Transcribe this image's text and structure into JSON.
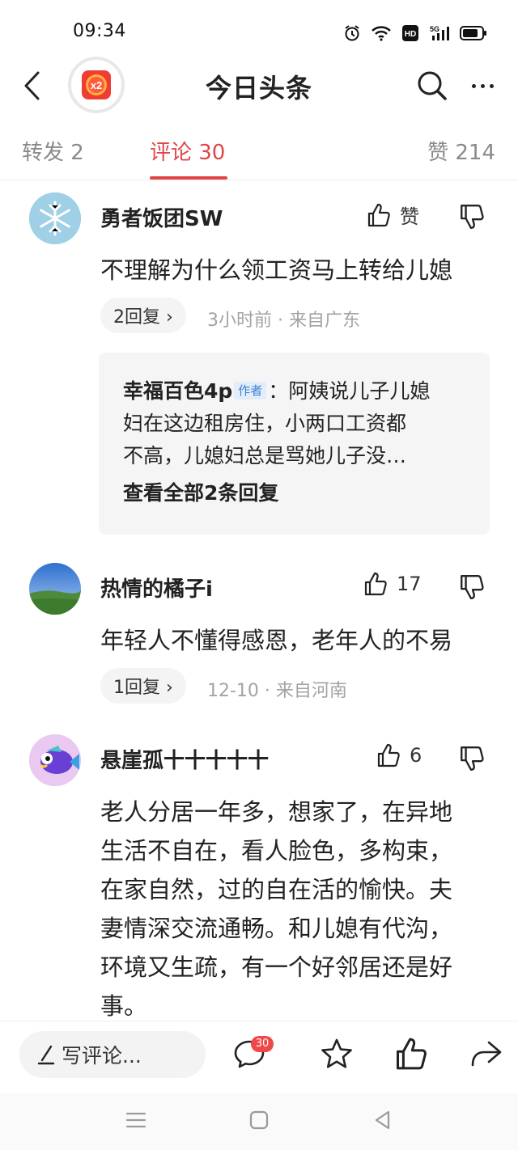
{
  "status_bar": {
    "time": "09:34",
    "icons": [
      "alarm-icon",
      "wifi-icon",
      "hd-icon",
      "5g-signal-icon",
      "battery-icon"
    ],
    "hd_label": "HD",
    "network_label": "5G"
  },
  "header": {
    "title": "今日头条",
    "redpack_label": "x2"
  },
  "tabs": {
    "repost": "转发 2",
    "comments": "评论 30",
    "likes": "赞 214"
  },
  "comments": [
    {
      "username": "勇者饭团SW",
      "like_label": "赞",
      "text": "不理解为什么领工资马上转给儿媳",
      "replies": "2回复 ›",
      "meta": "3小时前 · 来自广东",
      "reply_preview": {
        "user": "幸福百色4p",
        "badge": "作者",
        "text_line1": "：阿姨说儿子儿媳",
        "text_line2": "妇在这边租房住，小两口工资都",
        "text_line3": "不高，儿媳妇总是骂她儿子没…",
        "view_all": "查看全部2条回复"
      }
    },
    {
      "username": "热情的橘子i",
      "like_label": "17",
      "text": "年轻人不懂得感恩，老年人的不易",
      "replies": "1回复 ›",
      "meta": "12-10 · 来自河南"
    },
    {
      "username": "悬崖孤十十十十十",
      "like_label": "6",
      "text_lines": [
        "老人分居一年多，想家了，在异地",
        "生活不自在，看人脸色，多构束，",
        "在家自然，过的自在活的愉快。夫",
        "妻情深交流通畅。和儿媳有代沟，",
        "环境又生疏，有一个好邻居还是好",
        "事。"
      ]
    }
  ],
  "bottom_bar": {
    "write_placeholder": "写评论...",
    "comment_badge": "30"
  },
  "colors": {
    "accent": "#e04646",
    "muted": "#a3a3a3",
    "text": "#222222"
  }
}
